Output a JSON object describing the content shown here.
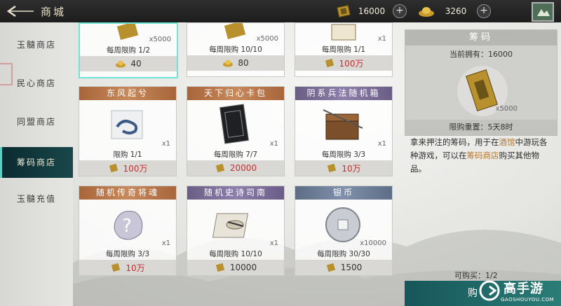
{
  "header": {
    "title": "商城",
    "currency1_value": "16000",
    "currency2_value": "3260"
  },
  "sidebar": {
    "items": [
      {
        "label": "玉髓商店"
      },
      {
        "label": "民心商店"
      },
      {
        "label": "同盟商店"
      },
      {
        "label": "筹码商店"
      },
      {
        "label": "玉髓充值"
      }
    ],
    "active_index": 3
  },
  "cards": [
    {
      "name": "",
      "qty": "x5000",
      "limit": "每周限购 1/2",
      "price": "40",
      "currency": "gold-ingot"
    },
    {
      "name": "",
      "qty": "x5000",
      "limit": "每周限购 10/10",
      "price": "80",
      "currency": "gold-ingot"
    },
    {
      "name": "",
      "qty": "x1",
      "limit": "每周限购 1/1",
      "price": "100万",
      "currency": "chip"
    },
    {
      "name": "东风起兮",
      "qty": "x1",
      "limit": "限购 1/1",
      "price": "100万",
      "currency": "chip"
    },
    {
      "name": "天下归心卡包",
      "qty": "x1",
      "limit": "每周限购 7/7",
      "price": "20000",
      "currency": "chip"
    },
    {
      "name": "阴系兵法随机箱",
      "qty": "x1",
      "limit": "每周限购 3/3",
      "price": "10万",
      "currency": "chip"
    },
    {
      "name": "随机传奇将魂",
      "qty": "x1",
      "limit": "每周限购 3/3",
      "price": "10万",
      "currency": "chip"
    },
    {
      "name": "随机史诗司南",
      "qty": "x1",
      "limit": "每周限购 10/10",
      "price": "10000",
      "currency": "chip"
    },
    {
      "name": "银币",
      "qty": "x10000",
      "limit": "每周限购 30/30",
      "price": "1500",
      "currency": "chip"
    }
  ],
  "detail": {
    "title": "筹码",
    "owned": "当前拥有：16000",
    "qty": "x5000",
    "reset": "限购重置：5天8时",
    "desc_pre": "拿来押注的筹码，用于在",
    "desc_hl1": "酒馆",
    "desc_mid": "中游玩各种游戏，可以在",
    "desc_hl2": "筹码商店",
    "desc_post": "购买其他物品。",
    "can_buy": "可购买：1/2",
    "buy_label": "购"
  },
  "watermark": {
    "text": "高手游",
    "sub": "GAOSHOUYOU.COM"
  },
  "colors": {
    "accent": "#6fe3d6",
    "price_red": "#c22f2f",
    "highlight": "#b7772b",
    "buy_button": "#1f6a69"
  }
}
